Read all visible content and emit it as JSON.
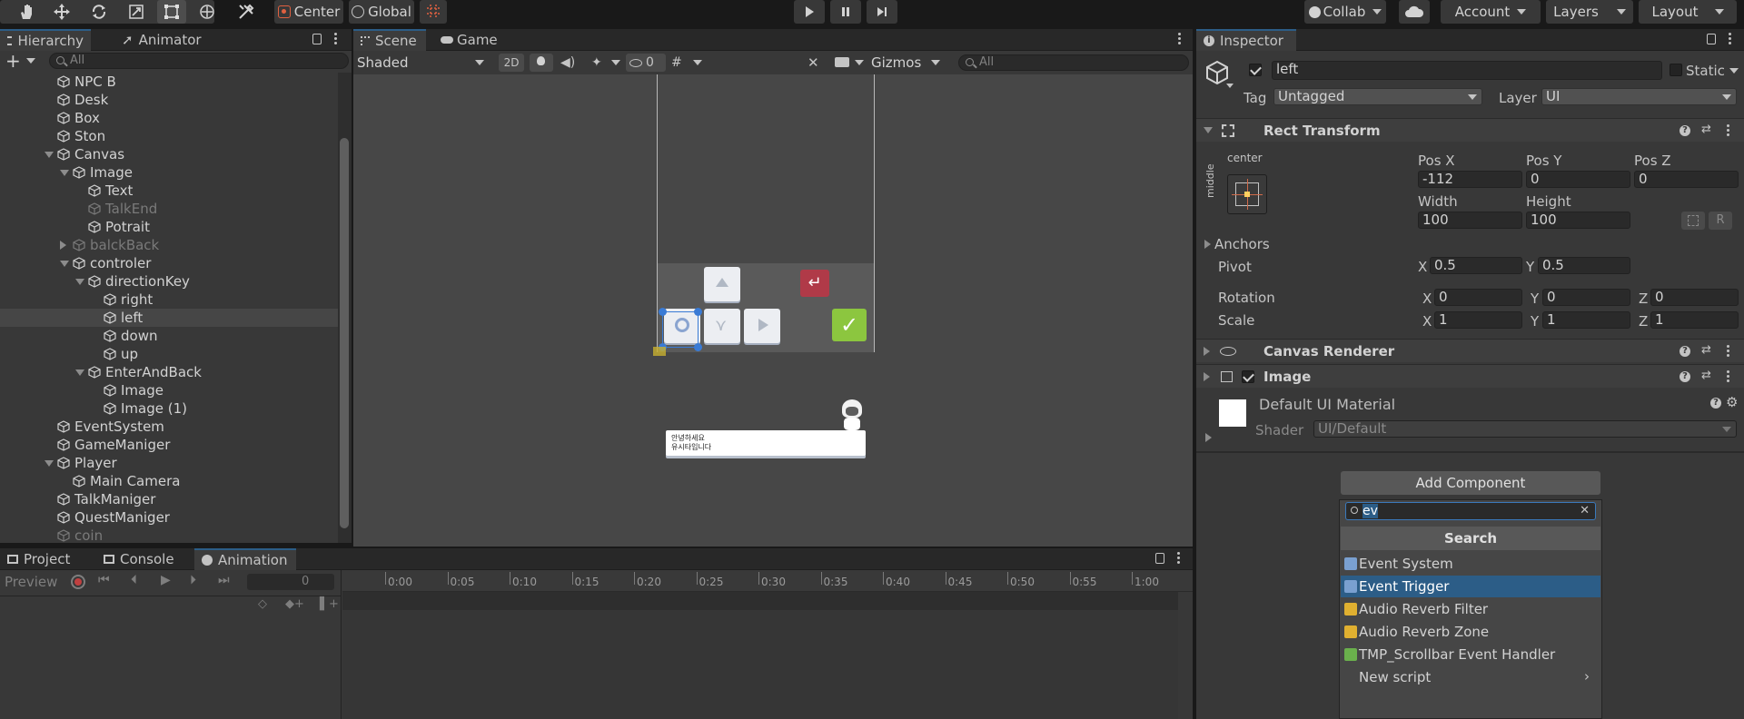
{
  "toolbar": {
    "tools": [
      "hand-tool",
      "move-tool",
      "rotate-tool",
      "scale-tool",
      "rect-tool",
      "transform-tool",
      "custom-tool"
    ],
    "pivot_label": "Center",
    "space_label": "Global",
    "collab_label": "Collab",
    "account_label": "Account",
    "layers_label": "Layers",
    "layout_label": "Layout"
  },
  "hierarchy": {
    "tab_label": "Hierarchy",
    "animator_tab": "Animator",
    "search_placeholder": "All",
    "items": [
      {
        "label": "NPC B",
        "indent": 0,
        "expander": "none",
        "state": "normal"
      },
      {
        "label": "Desk",
        "indent": 0,
        "expander": "none",
        "state": "normal"
      },
      {
        "label": "Box",
        "indent": 0,
        "expander": "none",
        "state": "normal"
      },
      {
        "label": "Ston",
        "indent": 0,
        "expander": "none",
        "state": "normal"
      },
      {
        "label": "Canvas",
        "indent": 0,
        "expander": "down",
        "state": "normal"
      },
      {
        "label": "Image",
        "indent": 1,
        "expander": "down",
        "state": "normal"
      },
      {
        "label": "Text",
        "indent": 2,
        "expander": "none",
        "state": "normal"
      },
      {
        "label": "TalkEnd",
        "indent": 2,
        "expander": "none",
        "state": "dim"
      },
      {
        "label": "Potrait",
        "indent": 2,
        "expander": "none",
        "state": "normal"
      },
      {
        "label": "balckBack",
        "indent": 1,
        "expander": "right",
        "state": "dim"
      },
      {
        "label": "controler",
        "indent": 1,
        "expander": "down",
        "state": "normal"
      },
      {
        "label": "directionKey",
        "indent": 2,
        "expander": "down",
        "state": "normal"
      },
      {
        "label": "right",
        "indent": 3,
        "expander": "none",
        "state": "normal"
      },
      {
        "label": "left",
        "indent": 3,
        "expander": "none",
        "state": "selected"
      },
      {
        "label": "down",
        "indent": 3,
        "expander": "none",
        "state": "normal"
      },
      {
        "label": "up",
        "indent": 3,
        "expander": "none",
        "state": "normal"
      },
      {
        "label": "EnterAndBack",
        "indent": 2,
        "expander": "down",
        "state": "normal"
      },
      {
        "label": "Image",
        "indent": 3,
        "expander": "none",
        "state": "normal"
      },
      {
        "label": "Image (1)",
        "indent": 3,
        "expander": "none",
        "state": "normal"
      },
      {
        "label": "EventSystem",
        "indent": 0,
        "expander": "none",
        "state": "normal"
      },
      {
        "label": "GameManiger",
        "indent": 0,
        "expander": "none",
        "state": "normal"
      },
      {
        "label": "Player",
        "indent": 0,
        "expander": "down",
        "state": "normal"
      },
      {
        "label": "Main Camera",
        "indent": 1,
        "expander": "none",
        "state": "normal"
      },
      {
        "label": "TalkManiger",
        "indent": 0,
        "expander": "none",
        "state": "normal"
      },
      {
        "label": "QuestManiger",
        "indent": 0,
        "expander": "none",
        "state": "normal"
      },
      {
        "label": "coin",
        "indent": 0,
        "expander": "none",
        "state": "dim"
      }
    ]
  },
  "scene": {
    "scene_tab": "Scene",
    "game_tab": "Game",
    "shading_mode": "Shaded",
    "mode_2d": "2D",
    "hidden_count": "0",
    "gizmos_label": "Gizmos",
    "search_placeholder": "All",
    "dialog_line1": "안녕하세요",
    "dialog_line2": "유시타입니다"
  },
  "bottom": {
    "project_tab": "Project",
    "console_tab": "Console",
    "animation_tab": "Animation",
    "preview_label": "Preview",
    "frame_value": "0",
    "timeline_ticks": [
      "0:00",
      "0:05",
      "0:10",
      "0:15",
      "0:20",
      "0:25",
      "0:30",
      "0:35",
      "0:40",
      "0:45",
      "0:50",
      "0:55",
      "1:00"
    ]
  },
  "inspector": {
    "tab_label": "Inspector",
    "object_name": "left",
    "static_label": "Static",
    "tag_label": "Tag",
    "tag_value": "Untagged",
    "layer_label": "Layer",
    "layer_value": "UI",
    "rect_transform": {
      "title": "Rect Transform",
      "anchor_h": "center",
      "anchor_v": "middle",
      "pos_x_label": "Pos X",
      "pos_y_label": "Pos Y",
      "pos_z_label": "Pos Z",
      "pos_x": "-112",
      "pos_y": "0",
      "pos_z": "0",
      "width_label": "Width",
      "height_label": "Height",
      "width": "100",
      "height": "100",
      "r_button": "R",
      "anchors_label": "Anchors",
      "pivot_label": "Pivot",
      "pivot_x": "0.5",
      "pivot_y": "0.5",
      "rotation_label": "Rotation",
      "rot_x": "0",
      "rot_y": "0",
      "rot_z": "0",
      "scale_label": "Scale",
      "scale_x": "1",
      "scale_y": "1",
      "scale_z": "1",
      "x": "X",
      "y": "Y",
      "z": "Z"
    },
    "canvas_renderer_title": "Canvas Renderer",
    "image_title": "Image",
    "material_name": "Default UI Material",
    "shader_label": "Shader",
    "shader_value": "UI/Default",
    "add_component_label": "Add Component",
    "ac_search_value": "ev",
    "ac_search_button": "Search",
    "ac_results": [
      {
        "label": "Event System",
        "icon": "event-system-icon",
        "selected": false
      },
      {
        "label": "Event Trigger",
        "icon": "event-trigger-icon",
        "selected": true
      },
      {
        "label": "Audio Reverb Filter",
        "icon": "audio-reverb-filter-icon",
        "selected": false
      },
      {
        "label": "Audio Reverb Zone",
        "icon": "audio-reverb-zone-icon",
        "selected": false
      },
      {
        "label": "TMP_Scrollbar Event Handler",
        "icon": "script-icon",
        "selected": false
      },
      {
        "label": "New script",
        "icon": "",
        "selected": false
      }
    ]
  },
  "colors": {
    "accent": "#2c5d87",
    "panel": "#383838",
    "dark": "#191919",
    "selected_row": "#464646",
    "back_button": "#b03a48",
    "ok_button": "#8cc63f"
  }
}
